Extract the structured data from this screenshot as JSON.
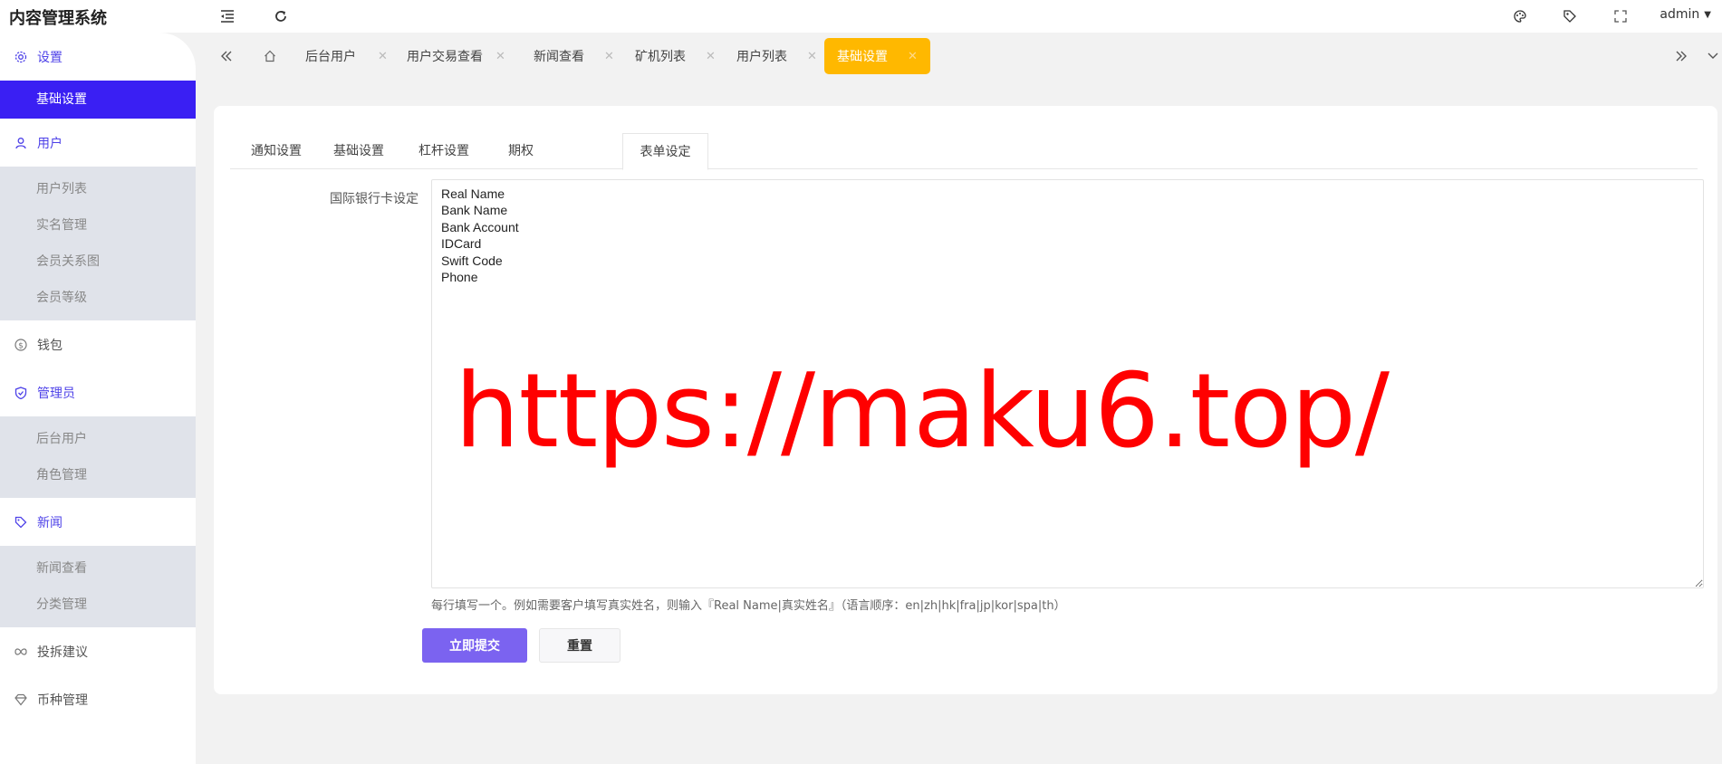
{
  "app": {
    "title": "内容管理系统",
    "user": "admin"
  },
  "sidebar": {
    "groups": [
      {
        "label": "设置",
        "icon": "gear-icon",
        "items": [
          "基础设置"
        ],
        "active_item": "基础设置"
      },
      {
        "label": "用户",
        "icon": "user-icon",
        "items": [
          "用户列表",
          "实名管理",
          "会员关系图",
          "会员等级"
        ]
      },
      {
        "label": "钱包",
        "icon": "dollar-icon",
        "items": []
      },
      {
        "label": "管理员",
        "icon": "shield-check-icon",
        "items": [
          "后台用户",
          "角色管理"
        ]
      },
      {
        "label": "新闻",
        "icon": "tag-icon",
        "items": [
          "新闻查看",
          "分类管理"
        ]
      },
      {
        "label": "投拆建议",
        "icon": "infinity-icon",
        "items": []
      },
      {
        "label": "币种管理",
        "icon": "diamond-icon",
        "items": []
      }
    ]
  },
  "page_tabs": [
    {
      "label": "后台用户"
    },
    {
      "label": "用户交易查看"
    },
    {
      "label": "新闻查看"
    },
    {
      "label": "矿机列表"
    },
    {
      "label": "用户列表"
    },
    {
      "label": "基础设置",
      "active": true
    }
  ],
  "settings_tabs": [
    "通知设置",
    "基础设置",
    "杠杆设置",
    "期权",
    "表单设定"
  ],
  "active_settings_tab": "表单设定",
  "form": {
    "label": "国际银行卡设定",
    "value": "Real Name\nBank Name\nBank Account\nIDCard\nSwift Code\nPhone",
    "hint": "每行填写一个。例如需要客户填写真实姓名，则输入『Real Name|真实姓名』（语言顺序：en|zh|hk|fra|jp|kor|spa|th）",
    "submit_label": "立即提交",
    "reset_label": "重置"
  },
  "watermark": "https://maku6.top/",
  "colors": {
    "primary": "#3a1ff3",
    "active_tab": "#ffb800",
    "submit": "#7b63f0",
    "watermark": "#ff0000"
  }
}
